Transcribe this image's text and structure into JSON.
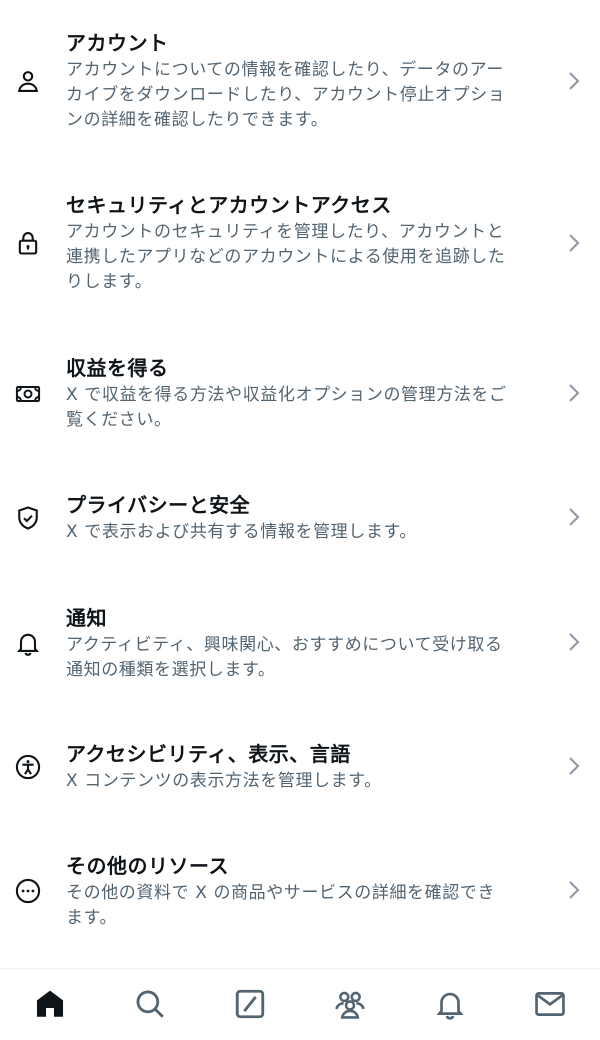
{
  "settings": {
    "items": [
      {
        "icon": "person-icon",
        "title": "アカウント",
        "desc_lines": [
          "アカウントについての情報を確認したり、データのアー",
          "カイブをダウンロードしたり、アカウント停止オプショ",
          "ンの詳細を確認したりできます。"
        ]
      },
      {
        "icon": "lock-icon",
        "title": "セキュリティとアカウントアクセス",
        "desc_lines": [
          "アカウントのセキュリティを管理したり、アカウントと",
          "連携したアプリなどのアカウントによる使用を追跡した",
          "りします。"
        ]
      },
      {
        "icon": "money-icon",
        "title": "収益を得る",
        "desc_lines": [
          "X で収益を得る方法や収益化オプションの管理方法をご",
          "覧ください。"
        ]
      },
      {
        "icon": "shield-icon",
        "title": "プライバシーと安全",
        "desc_lines": [
          "X で表示および共有する情報を管理します。"
        ]
      },
      {
        "icon": "bell-icon",
        "title": "通知",
        "desc_lines": [
          "アクティビティ、興味関心、おすすめについて受け取る",
          "通知の種類を選択します。"
        ]
      },
      {
        "icon": "accessibility-icon",
        "title": "アクセシビリティ、表示、言語",
        "desc_lines": [
          "X コンテンツの表示方法を管理します。"
        ]
      },
      {
        "icon": "more-icon",
        "title": "その他のリソース",
        "desc_lines": [
          "その他の資料で X の商品やサービスの詳細を確認でき",
          "ます。"
        ]
      }
    ]
  },
  "bottom_nav": {
    "items": [
      "home-icon",
      "search-icon",
      "grok-icon",
      "communities-icon",
      "notifications-icon",
      "messages-icon"
    ],
    "active": "home-icon"
  }
}
